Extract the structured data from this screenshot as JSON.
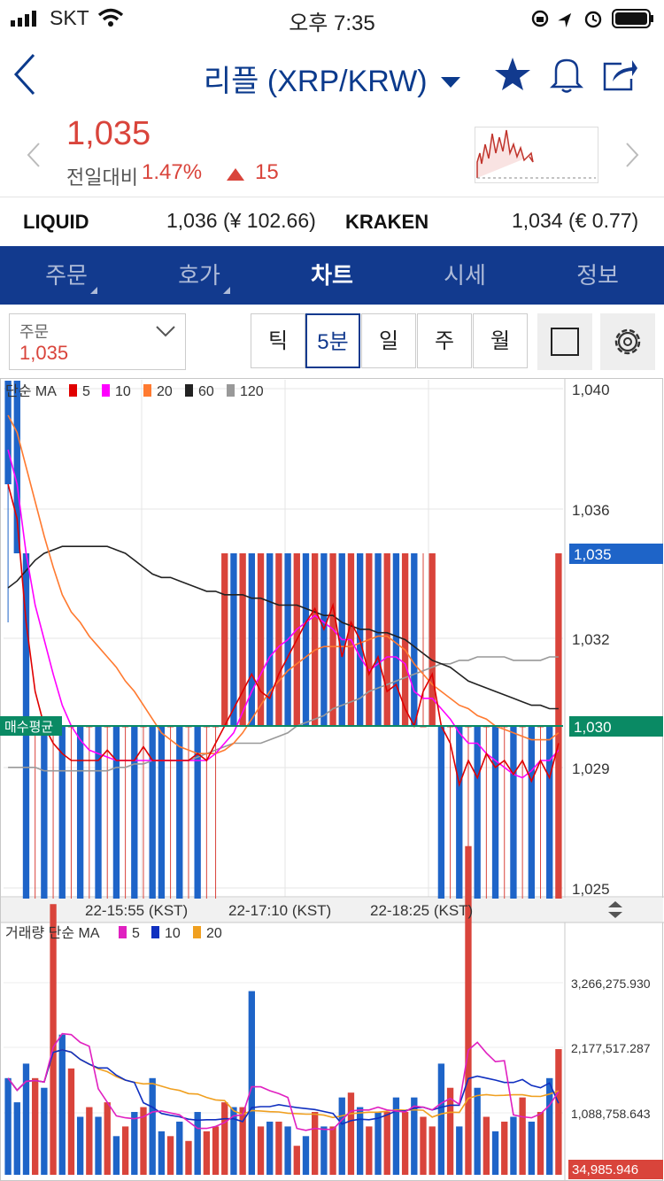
{
  "status": {
    "carrier": "SKT",
    "time": "오후 7:35"
  },
  "header": {
    "title": "리플 (XRP/KRW)"
  },
  "price": {
    "current": "1,035",
    "change_label": "전일대비",
    "change_pct": "1.47%",
    "change_abs": "15"
  },
  "exchanges": [
    {
      "name": "LIQUID",
      "value": "1,036 (¥ 102.66)"
    },
    {
      "name": "KRAKEN",
      "value": "1,034 (€ 0.77)"
    }
  ],
  "tabs": [
    "주문",
    "호가",
    "차트",
    "시세",
    "정보"
  ],
  "active_tab": "차트",
  "order": {
    "label": "주문",
    "value": "1,035"
  },
  "periods": [
    "틱",
    "5분",
    "일",
    "주",
    "월"
  ],
  "active_period": "5분",
  "colors": {
    "up": "#d9443b",
    "down": "#1e64c8",
    "brand": "#123a8e",
    "avg_line": "#0a8a64"
  },
  "chart_data": {
    "type": "candlestick",
    "price_legend": {
      "title": "단순 MA",
      "items": [
        {
          "name": "5",
          "color": "#e00000"
        },
        {
          "name": "10",
          "color": "#ff00ff"
        },
        {
          "name": "20",
          "color": "#ff7a30"
        },
        {
          "name": "60",
          "color": "#222222"
        },
        {
          "name": "120",
          "color": "#999999"
        }
      ]
    },
    "y_ticks": [
      "1,040",
      "1,036",
      "1,032",
      "1,029",
      "1,025"
    ],
    "current_price_label": "1,035",
    "avg_price_label": "1,030",
    "avg_price_title": "매수평균",
    "x_ticks": [
      "22-15:55 (KST)",
      "22-17:10 (KST)",
      "22-18:25 (KST)"
    ],
    "volume_legend": {
      "title": "거래량 단순 MA",
      "items": [
        {
          "name": "5",
          "color": "#e020c0"
        },
        {
          "name": "10",
          "color": "#1030c0"
        },
        {
          "name": "20",
          "color": "#f0a020"
        }
      ]
    },
    "volume_ticks": [
      "3,266,275.930",
      "2,177,517.287",
      "1,088,758.643"
    ],
    "volume_current": "34,985.946",
    "candles": [
      [
        1040,
        1040,
        1033,
        1037
      ],
      [
        1040,
        1040,
        1035,
        1035
      ],
      [
        1035,
        1035,
        1025,
        1025
      ],
      [
        1030,
        1030,
        1025,
        1030
      ],
      [
        1030,
        1030,
        1025,
        1025
      ],
      [
        1030,
        1030,
        1025,
        1030
      ],
      [
        1030,
        1030,
        1025,
        1025
      ],
      [
        1030,
        1030,
        1025,
        1030
      ],
      [
        1030,
        1030,
        1025,
        1025
      ],
      [
        1030,
        1030,
        1025,
        1030
      ],
      [
        1030,
        1030,
        1025,
        1025
      ],
      [
        1030,
        1030,
        1025,
        1030
      ],
      [
        1030,
        1030,
        1025,
        1025
      ],
      [
        1030,
        1030,
        1025,
        1030
      ],
      [
        1030,
        1030,
        1025,
        1025
      ],
      [
        1030,
        1030,
        1025,
        1030
      ],
      [
        1030,
        1030,
        1025,
        1025
      ],
      [
        1030,
        1030,
        1025,
        1025
      ],
      [
        1030,
        1030,
        1025,
        1030
      ],
      [
        1030,
        1030,
        1025,
        1025
      ],
      [
        1030,
        1030,
        1025,
        1030
      ],
      [
        1030,
        1030,
        1025,
        1025
      ],
      [
        1030,
        1030,
        1025,
        1030
      ],
      [
        1030,
        1030,
        1025,
        1030
      ],
      [
        1030,
        1035,
        1030,
        1035
      ],
      [
        1035,
        1035,
        1030,
        1030
      ],
      [
        1030,
        1035,
        1030,
        1035
      ],
      [
        1035,
        1035,
        1030,
        1030
      ],
      [
        1030,
        1035,
        1030,
        1035
      ],
      [
        1035,
        1035,
        1030,
        1030
      ],
      [
        1030,
        1035,
        1030,
        1035
      ],
      [
        1035,
        1035,
        1030,
        1030
      ],
      [
        1030,
        1035,
        1030,
        1035
      ],
      [
        1035,
        1035,
        1030,
        1030
      ],
      [
        1030,
        1035,
        1030,
        1035
      ],
      [
        1035,
        1035,
        1030,
        1030
      ],
      [
        1030,
        1035,
        1030,
        1035
      ],
      [
        1035,
        1035,
        1030,
        1030
      ],
      [
        1030,
        1035,
        1030,
        1035
      ],
      [
        1035,
        1035,
        1030,
        1030
      ],
      [
        1030,
        1035,
        1030,
        1035
      ],
      [
        1035,
        1035,
        1030,
        1030
      ],
      [
        1030,
        1035,
        1030,
        1035
      ],
      [
        1035,
        1035,
        1030,
        1030
      ],
      [
        1030,
        1035,
        1030,
        1035
      ],
      [
        1035,
        1035,
        1030,
        1030
      ],
      [
        1030,
        1035,
        1030,
        1030
      ],
      [
        1030,
        1035,
        1030,
        1035
      ],
      [
        1030,
        1030,
        1025,
        1025
      ],
      [
        1030,
        1030,
        1025,
        1030
      ],
      [
        1030,
        1030,
        1025,
        1025
      ],
      [
        1030,
        1030,
        1025,
        1030
      ],
      [
        1030,
        1030,
        1025,
        1025
      ],
      [
        1030,
        1030,
        1025,
        1030
      ],
      [
        1030,
        1030,
        1025,
        1025
      ],
      [
        1030,
        1030,
        1025,
        1030
      ],
      [
        1030,
        1030,
        1025,
        1025
      ],
      [
        1030,
        1030,
        1025,
        1030
      ],
      [
        1030,
        1030,
        1025,
        1025
      ],
      [
        1030,
        1030,
        1025,
        1030
      ],
      [
        1030,
        1030,
        1025,
        1025
      ],
      [
        1025,
        1035,
        1025,
        1035
      ]
    ],
    "ma5": [
      1037,
      1036,
      1033,
      1031,
      1030,
      1029.5,
      1029.2,
      1029,
      1029,
      1029,
      1029,
      1029.3,
      1029,
      1029,
      1029,
      1029.4,
      1029,
      1029,
      1029,
      1029,
      1029,
      1029.2,
      1029,
      1029.5,
      1030,
      1030.5,
      1031,
      1031.5,
      1031,
      1030.8,
      1031.5,
      1032,
      1032.5,
      1033,
      1033.4,
      1032.8,
      1033.5,
      1032,
      1033,
      1032.5,
      1031.5,
      1032,
      1031,
      1031.2,
      1030.5,
      1030,
      1031,
      1031.5,
      1030,
      1029.5,
      1028.3,
      1029,
      1028.5,
      1029.2,
      1028.8,
      1029,
      1028.6,
      1029,
      1028.4,
      1029,
      1028.5,
      1029.5
    ],
    "ma10": [
      1038,
      1037,
      1035,
      1033.5,
      1032.5,
      1031.5,
      1030.6,
      1030,
      1029.6,
      1029.3,
      1029.2,
      1029.1,
      1029,
      1029,
      1029,
      1029,
      1029,
      1029,
      1029,
      1029,
      1029,
      1029,
      1029,
      1029.2,
      1029.5,
      1029.8,
      1030.4,
      1031,
      1031.5,
      1032,
      1032.3,
      1032.5,
      1032.8,
      1033,
      1033.2,
      1033,
      1032.8,
      1032.5,
      1032.5,
      1032,
      1031.6,
      1031.8,
      1032,
      1032,
      1031.8,
      1031,
      1030.8,
      1030.8,
      1030.5,
      1030.2,
      1029.8,
      1029.5,
      1029.5,
      1029.2,
      1029,
      1028.8,
      1028.6,
      1028.5,
      1028.7,
      1029,
      1029,
      1029.3
    ],
    "ma20": [
      1039,
      1038.5,
      1037.5,
      1036.5,
      1035.5,
      1034.6,
      1033.8,
      1033.3,
      1033,
      1032.6,
      1032.3,
      1032,
      1031.7,
      1031.3,
      1031,
      1030.6,
      1030.2,
      1029.8,
      1029.6,
      1029.4,
      1029.3,
      1029.2,
      1029.2,
      1029.2,
      1029.3,
      1029.5,
      1029.8,
      1030.2,
      1030.6,
      1031,
      1031.3,
      1031.6,
      1031.8,
      1032,
      1032.2,
      1032.3,
      1032.3,
      1032.3,
      1032.3,
      1032.4,
      1032.5,
      1032.6,
      1032.6,
      1032.4,
      1032.2,
      1031.8,
      1031.5,
      1031.2,
      1031,
      1030.8,
      1030.6,
      1030.5,
      1030.3,
      1030.2,
      1030,
      1029.9,
      1029.8,
      1029.7,
      1029.6,
      1029.6,
      1029.6,
      1029.8
    ],
    "ma60": [
      1034,
      1034.2,
      1034.5,
      1034.8,
      1035,
      1035.1,
      1035.2,
      1035.2,
      1035.2,
      1035.2,
      1035.2,
      1035.2,
      1035.1,
      1035,
      1034.8,
      1034.6,
      1034.4,
      1034.3,
      1034.3,
      1034.2,
      1034.1,
      1034,
      1033.9,
      1033.9,
      1033.8,
      1033.8,
      1033.8,
      1033.7,
      1033.7,
      1033.6,
      1033.5,
      1033.5,
      1033.5,
      1033.4,
      1033.3,
      1033.2,
      1033.2,
      1033,
      1032.9,
      1032.8,
      1032.8,
      1032.7,
      1032.7,
      1032.6,
      1032.5,
      1032.3,
      1032.1,
      1031.9,
      1031.8,
      1031.7,
      1031.5,
      1031.3,
      1031.2,
      1031.1,
      1031,
      1030.9,
      1030.8,
      1030.7,
      1030.6,
      1030.6,
      1030.5,
      1030.5
    ],
    "ma120": [
      1028.8,
      1028.8,
      1028.8,
      1028.8,
      1028.7,
      1028.7,
      1028.7,
      1028.7,
      1028.7,
      1028.7,
      1028.7,
      1028.7,
      1028.8,
      1028.8,
      1028.9,
      1028.9,
      1029,
      1029,
      1029,
      1029,
      1029,
      1029.1,
      1029.2,
      1029.3,
      1029.4,
      1029.5,
      1029.5,
      1029.5,
      1029.5,
      1029.6,
      1029.7,
      1029.8,
      1030,
      1030.1,
      1030.2,
      1030.3,
      1030.5,
      1030.6,
      1030.7,
      1030.8,
      1031,
      1031.1,
      1031.2,
      1031.3,
      1031.4,
      1031.5,
      1031.6,
      1031.7,
      1031.8,
      1031.8,
      1031.9,
      1031.9,
      1032,
      1032,
      1032,
      1032,
      1031.9,
      1031.9,
      1031.9,
      1031.9,
      1032,
      1032
    ],
    "volumes": [
      2.0,
      1.5,
      2.3,
      2.0,
      1.8,
      5.6,
      2.9,
      2.2,
      1.2,
      1.4,
      1.2,
      1.5,
      0.8,
      1.0,
      1.3,
      1.4,
      2.0,
      0.9,
      0.8,
      1.1,
      0.7,
      1.3,
      0.9,
      1.0,
      1.5,
      1.4,
      1.4,
      3.8,
      1.0,
      1.1,
      1.1,
      1.0,
      0.6,
      0.8,
      1.3,
      1.0,
      1.0,
      1.6,
      1.7,
      1.4,
      1.0,
      1.3,
      1.3,
      1.6,
      1.3,
      1.6,
      1.2,
      1.0,
      2.3,
      1.8,
      1.0,
      6.8,
      1.8,
      1.2,
      0.9,
      1.1,
      1.2,
      1.6,
      1.1,
      1.3,
      2.0,
      2.6
    ]
  }
}
